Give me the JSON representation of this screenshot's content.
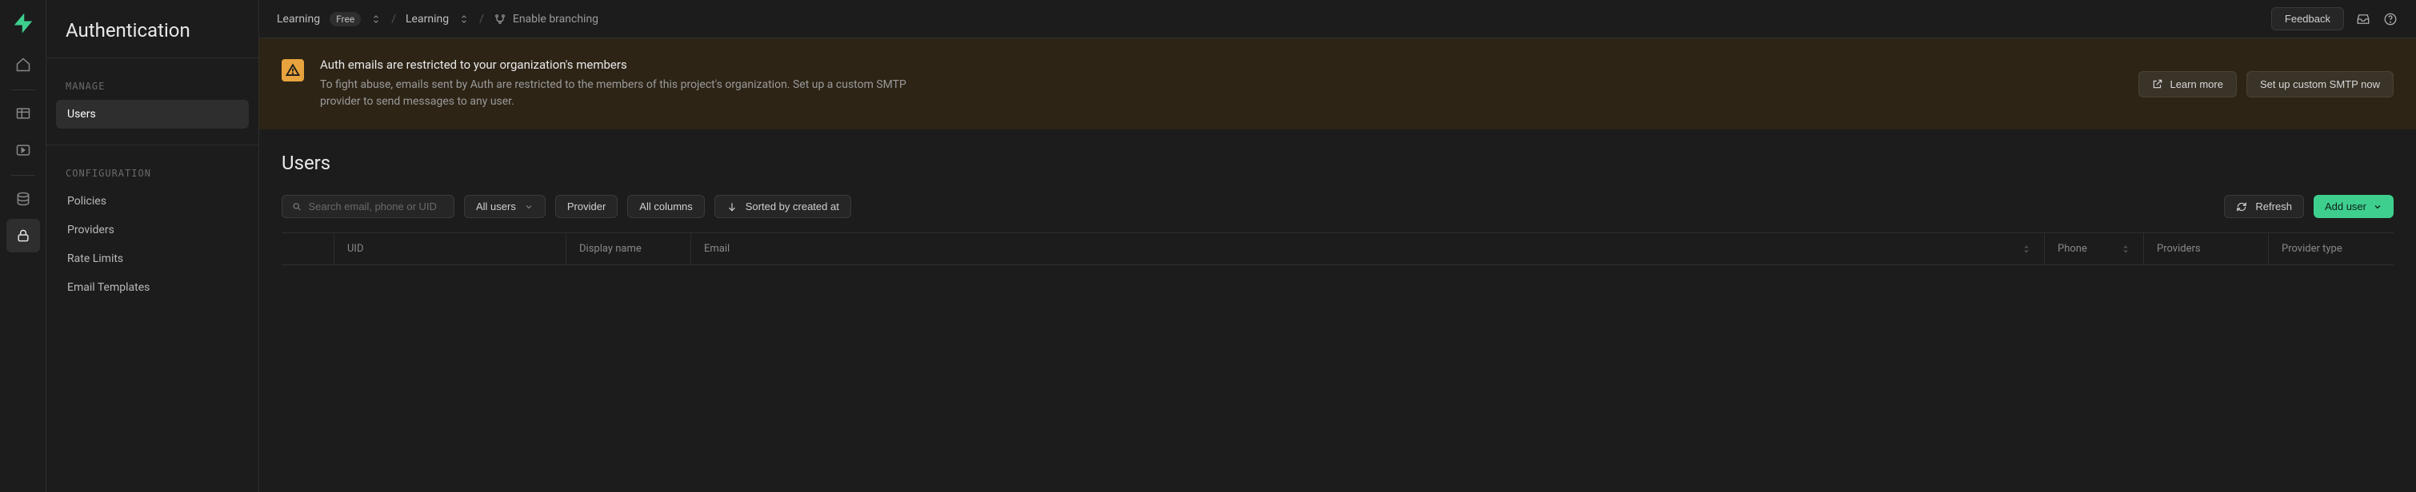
{
  "sidebar": {
    "title": "Authentication",
    "sections": {
      "manage": {
        "label": "MANAGE",
        "items": [
          "Users"
        ]
      },
      "config": {
        "label": "CONFIGURATION",
        "items": [
          "Policies",
          "Providers",
          "Rate Limits",
          "Email Templates"
        ]
      }
    },
    "active": "Users"
  },
  "topbar": {
    "org": "Learning",
    "badge": "Free",
    "project": "Learning",
    "branching": "Enable branching",
    "feedback": "Feedback"
  },
  "banner": {
    "title": "Auth emails are restricted to your organization's members",
    "desc": "To fight abuse, emails sent by Auth are restricted to the members of this project's organization. Set up a custom SMTP provider to send messages to any user.",
    "learn_more": "Learn more",
    "setup": "Set up custom SMTP now"
  },
  "page": {
    "title": "Users",
    "search_placeholder": "Search email, phone or UID",
    "filter_users": "All users",
    "provider": "Provider",
    "columns": "All columns",
    "sorted": "Sorted by created at",
    "refresh": "Refresh",
    "add_user": "Add user"
  },
  "table": {
    "headers": {
      "uid": "UID",
      "display_name": "Display name",
      "email": "Email",
      "phone": "Phone",
      "providers": "Providers",
      "provider_type": "Provider type"
    }
  }
}
